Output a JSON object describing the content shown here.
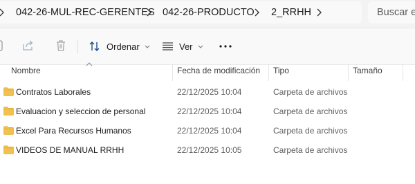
{
  "breadcrumbs": [
    "042-26-MUL-REC-GERENTES",
    "042-26-PRODUCTO",
    "2_RRHH"
  ],
  "search": {
    "placeholder": "Buscar en"
  },
  "toolbar": {
    "sort_label": "Ordenar",
    "view_label": "Ver",
    "icons": [
      "copy-icon",
      "share-icon",
      "delete-icon",
      "sort-icon",
      "view-icon",
      "more-options-icon"
    ]
  },
  "columns": {
    "name": "Nombre",
    "date": "Fecha de modificación",
    "type": "Tipo",
    "size": "Tamaño"
  },
  "rows": [
    {
      "name": "Contratos Laborales",
      "date": "22/12/2025 10:04",
      "type": "Carpeta de archivos",
      "size": ""
    },
    {
      "name": "Evaluacion y seleccion de personal",
      "date": "22/12/2025 10:04",
      "type": "Carpeta de archivos",
      "size": ""
    },
    {
      "name": "Excel Para Recursos Humanos",
      "date": "22/12/2025 10:04",
      "type": "Carpeta de archivos",
      "size": ""
    },
    {
      "name": "VIDEOS DE MANUAL RRHH",
      "date": "22/12/2025 10:05",
      "type": "Carpeta de archivos",
      "size": ""
    }
  ],
  "colors": {
    "folder": "#f2c14e",
    "folder_dark": "#dca32a",
    "accent": "#0067c0"
  }
}
